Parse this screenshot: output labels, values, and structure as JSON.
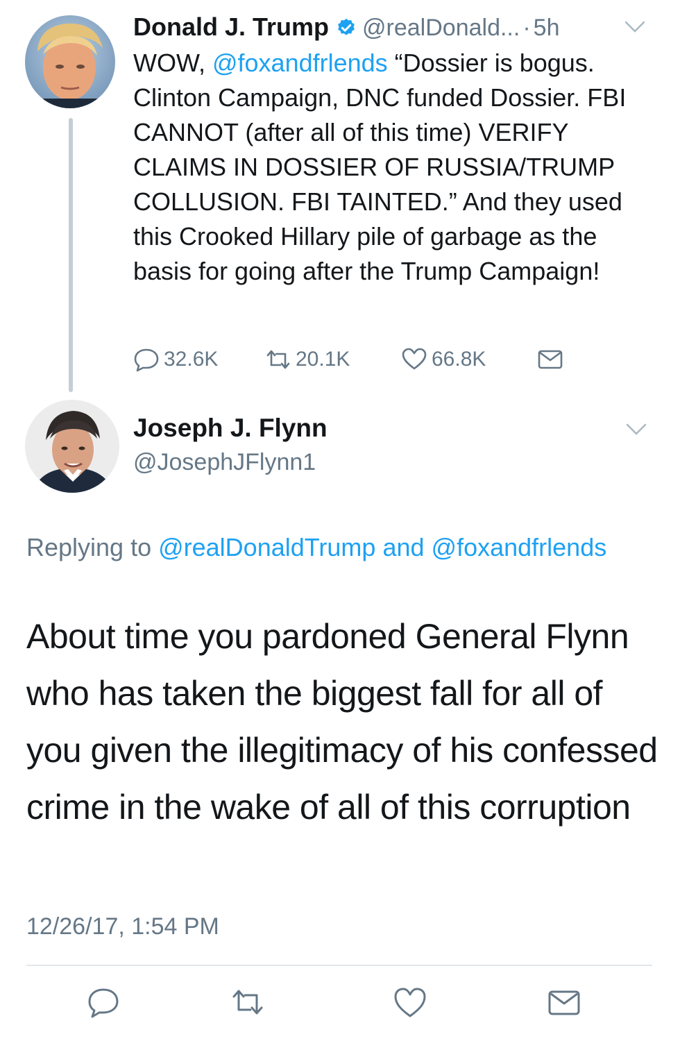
{
  "parent_tweet": {
    "avatar_icon": "trump-avatar",
    "author_name": "Donald J. Trump",
    "verified_icon": "verified-badge-icon",
    "handle": "@realDonald...",
    "separator": "·",
    "time": "5h",
    "text_mention": "@foxandfrlends",
    "text_before_mention": "WOW, ",
    "text_after_mention": "  “Dossier is bogus. Clinton Campaign, DNC funded Dossier. FBI CANNOT (after all of this time) VERIFY CLAIMS IN DOSSIER OF RUSSIA/TRUMP COLLUSION. FBI TAINTED.” And they used this Crooked Hillary pile of garbage as the basis for going after the Trump Campaign!",
    "replies_count": "32.6K",
    "retweets_count": "20.1K",
    "likes_count": "66.8K"
  },
  "reply_tweet": {
    "avatar_icon": "flynn-avatar",
    "author_name": "Joseph J. Flynn",
    "handle": "@JosephJFlynn1",
    "replying_label": "Replying to ",
    "replying_to_1": "@realDonaldTrump",
    "replying_and": " and ",
    "replying_to_2": "@foxandfrlends",
    "text": "About time you pardoned General Flynn who has taken the biggest fall for all of you given the illegitimacy of his confessed crime in the wake of all of this corruption",
    "timestamp": "12/26/17, 1:54 PM"
  },
  "colors": {
    "text": "#14171a",
    "secondary": "#657786",
    "link": "#1da1f2",
    "thread_line": "#c4ced6",
    "divider": "#e1e8ed"
  },
  "icons": {
    "reply": "reply-icon",
    "retweet": "retweet-icon",
    "like": "heart-icon",
    "dm": "envelope-icon",
    "caret": "chevron-down-icon"
  }
}
